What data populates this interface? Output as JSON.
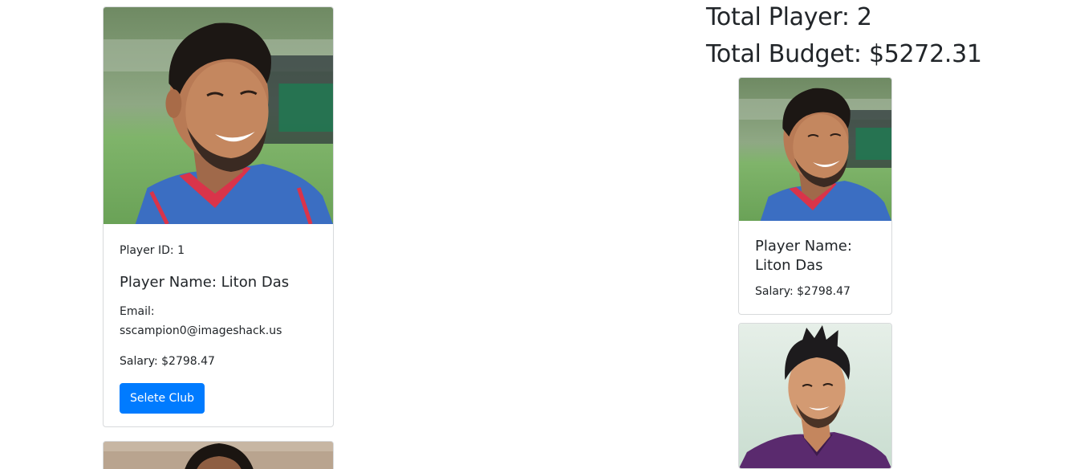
{
  "players": [
    {
      "id_text": "Player ID: 1",
      "name_text": "Player Name: Liton Das",
      "email_label": "Email:",
      "email": "sscampion0@imageshack.us",
      "salary_text": "Salary: $2798.47",
      "button_label": "Selete Club"
    }
  ],
  "summary": {
    "total_player_text": "Total Player: 2",
    "total_budget_text": "Total Budget: $5272.31"
  },
  "selected": [
    {
      "name_line1": "Player Name:",
      "name_line2": "Liton Das",
      "salary_text": "Salary: $2798.47"
    }
  ],
  "colors": {
    "primary_button": "#007bff",
    "text": "#212529",
    "card_border": "#d8dadc"
  }
}
